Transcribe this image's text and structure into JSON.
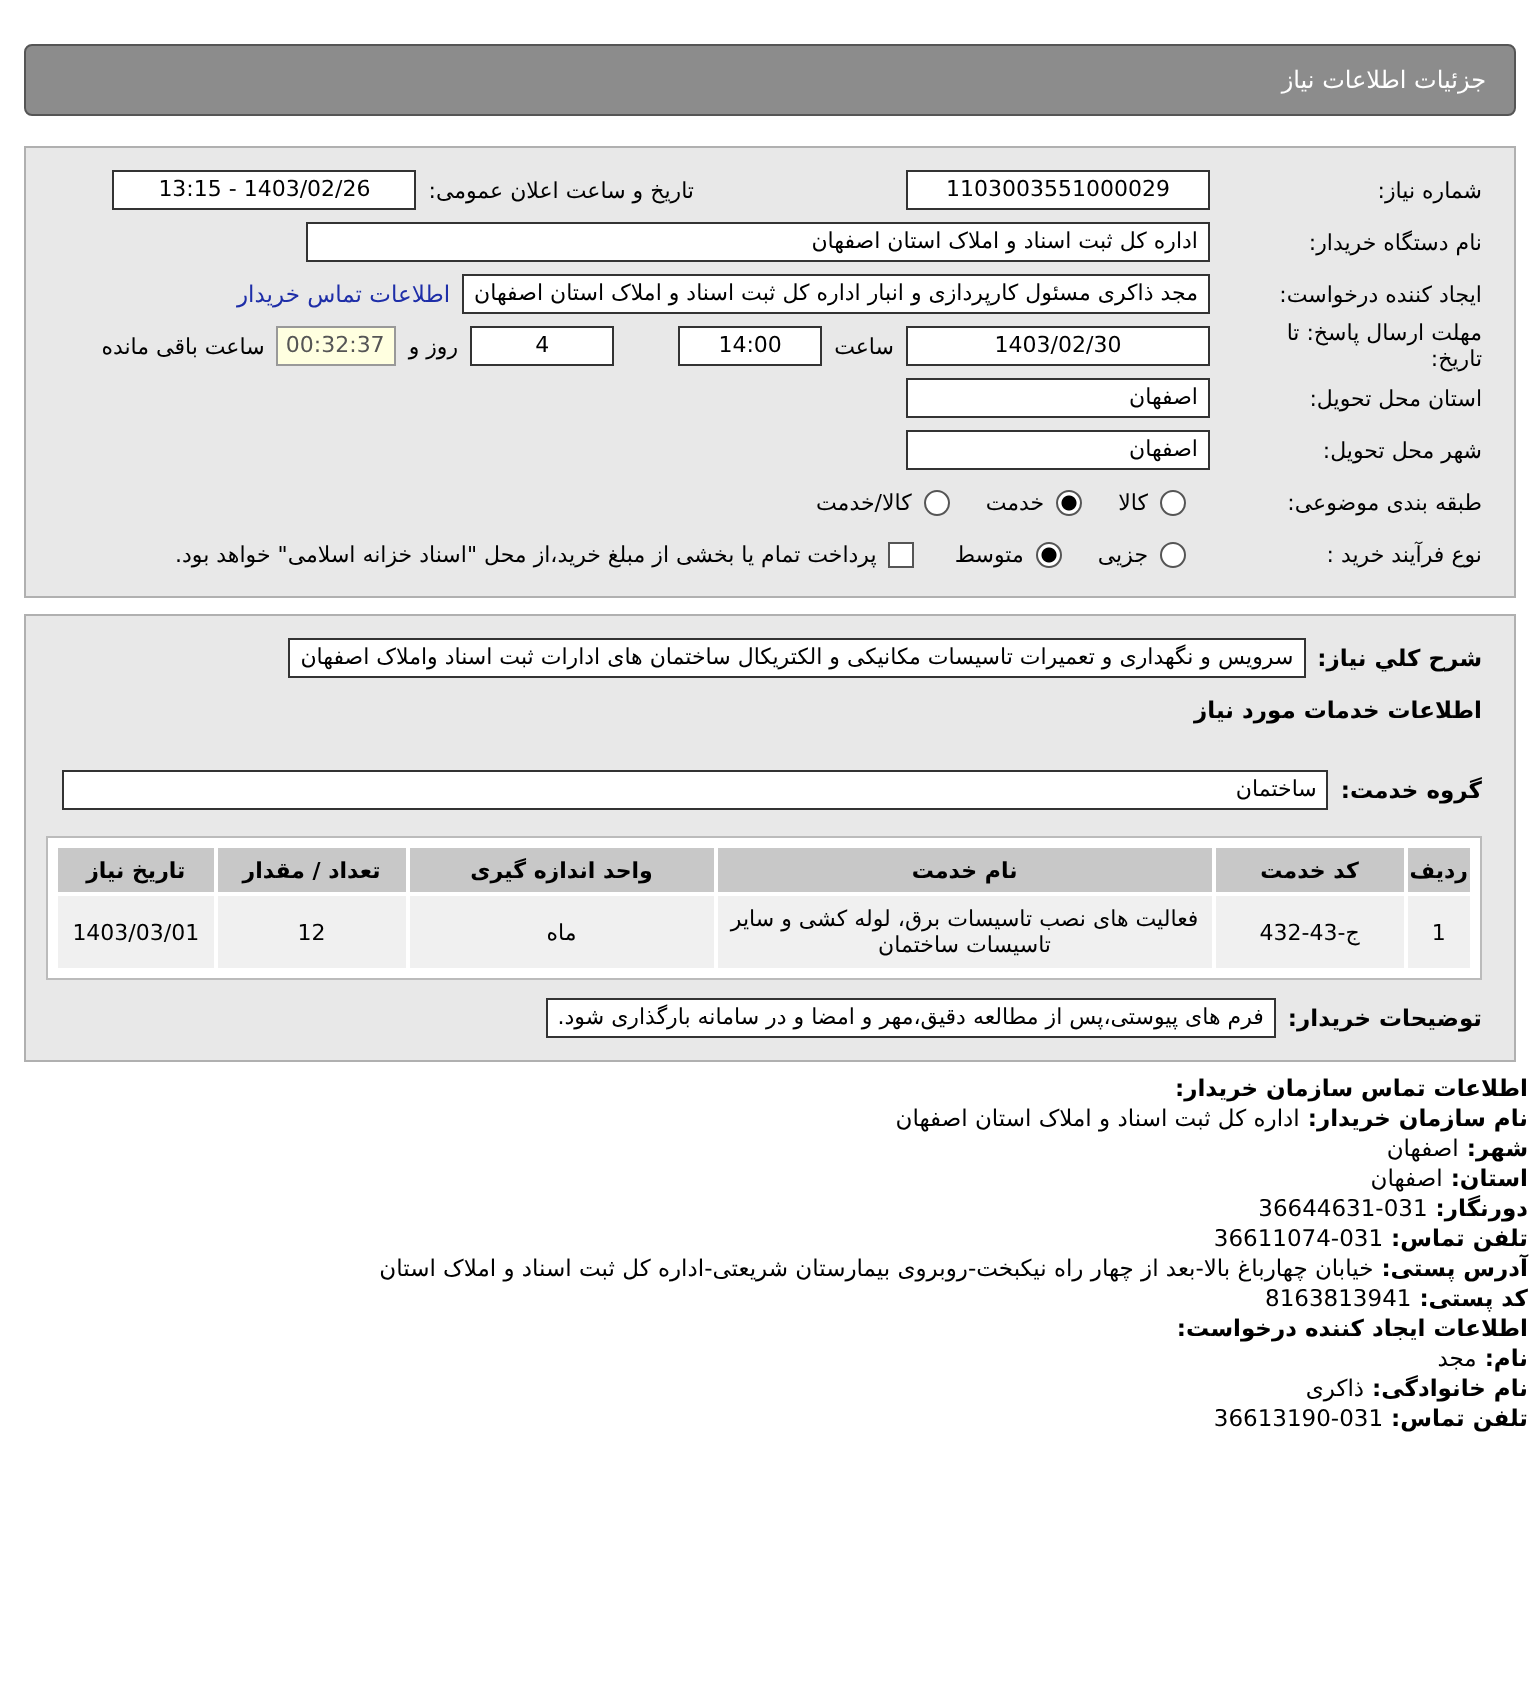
{
  "header": {
    "title": "جزئیات اطلاعات نیاز"
  },
  "form": {
    "need_number": {
      "label": "شماره نیاز:",
      "value": "1103003551000029"
    },
    "announce": {
      "label": "تاریخ و ساعت اعلان عمومی:",
      "value": "1403/02/26 - 13:15"
    },
    "buyer_org": {
      "label": "نام دستگاه خریدار:",
      "value": "اداره کل ثبت اسناد و املاک استان اصفهان"
    },
    "requester": {
      "label": "ایجاد کننده درخواست:",
      "value": "مجد ذاکری مسئول کارپردازی و انبار اداره کل ثبت اسناد و املاک استان اصفهان",
      "link": "اطلاعات تماس خریدار"
    },
    "deadline": {
      "label": "مهلت ارسال پاسخ: تا تاریخ:",
      "date": "1403/02/30",
      "time_label": "ساعت",
      "time": "14:00",
      "days": "4",
      "days_label": "روز و",
      "remaining": "00:32:37",
      "remaining_label": "ساعت باقی مانده"
    },
    "province": {
      "label": "استان محل تحویل:",
      "value": "اصفهان"
    },
    "city": {
      "label": "شهر محل تحویل:",
      "value": "اصفهان"
    },
    "category": {
      "label": "طبقه بندی موضوعی:",
      "options": [
        {
          "label": "کالا",
          "selected": false
        },
        {
          "label": "خدمت",
          "selected": true
        },
        {
          "label": "کالا/خدمت",
          "selected": false
        }
      ]
    },
    "process": {
      "label": "نوع فرآیند خرید :",
      "options": [
        {
          "label": "جزیی",
          "selected": false
        },
        {
          "label": "متوسط",
          "selected": true
        }
      ],
      "checkbox": {
        "label": "پرداخت تمام یا بخشی از مبلغ خرید،از محل \"اسناد خزانه اسلامی\" خواهد بود.",
        "checked": false
      }
    }
  },
  "details": {
    "summary": {
      "label": "شرح کلي نياز:",
      "value": "سرویس و نگهداری و تعمیرات تاسیسات مکانیکی و الکتریکال ساختمان های ادارات ثبت اسناد واملاک اصفهان"
    },
    "services_title": "اطلاعات خدمات مورد نیاز",
    "service_group": {
      "label": "گروه خدمت:",
      "value": "ساختمان"
    },
    "table": {
      "columns": [
        "ردیف",
        "کد خدمت",
        "نام خدمت",
        "واحد اندازه گیری",
        "تعداد / مقدار",
        "تاریخ نیاز"
      ],
      "rows": [
        [
          "1",
          "ج-43-432",
          "فعالیت های نصب تاسیسات برق، لوله کشی و سایر تاسیسات ساختمان",
          "ماه",
          "12",
          "1403/03/01"
        ]
      ]
    },
    "buyer_notes": {
      "label": "توضیحات خریدار:",
      "value": "فرم های پیوستی،پس از مطالعه دقیق،مهر و امضا و در سامانه بارگذاری شود."
    }
  },
  "contact": {
    "title": "اطلاعات تماس سازمان خریدار:",
    "lines": [
      {
        "label": "نام سازمان خریدار:",
        "value": "اداره کل ثبت اسناد و املاک استان اصفهان"
      },
      {
        "label": "شهر:",
        "value": "اصفهان"
      },
      {
        "label": "استان:",
        "value": "اصفهان"
      },
      {
        "label": "دورنگار:",
        "value": "031-36644631"
      },
      {
        "label": "تلفن تماس:",
        "value": "031-36611074"
      },
      {
        "label": "آدرس پستی:",
        "value": "خیابان چهارباغ بالا-بعد از چهار راه نیکبخت-روبروی بیمارستان شریعتی-اداره کل ثبت اسناد و املاک استان"
      },
      {
        "label": "کد پستی:",
        "value": "8163813941"
      }
    ],
    "creator_title": "اطلاعات ایجاد کننده درخواست:",
    "creator_lines": [
      {
        "label": "نام:",
        "value": "مجد"
      },
      {
        "label": "نام خانوادگی:",
        "value": "ذاکری"
      },
      {
        "label": "تلفن تماس:",
        "value": "031-36613190"
      }
    ]
  }
}
